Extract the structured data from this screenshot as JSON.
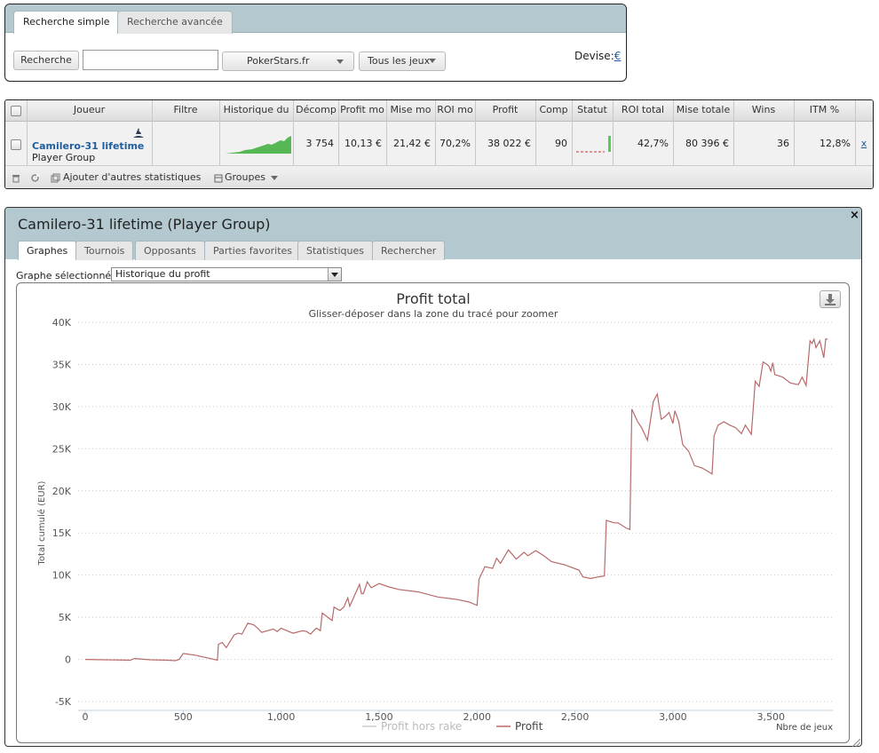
{
  "search": {
    "tabs": [
      "Recherche simple",
      "Recherche avancée"
    ],
    "search_button": "Recherche",
    "search_value": "",
    "site": "PokerStars.fr",
    "games": "Tous les jeux",
    "currency_label": "Devise:",
    "currency_symbol": "€"
  },
  "table": {
    "headers": [
      "Joueur",
      "Filtre",
      "Historique du",
      "Décomp",
      "Profit mo",
      "Mise mo",
      "ROI mo",
      "Profit",
      "Comp",
      "Statut",
      "ROI total",
      "Mise totale",
      "Wins",
      "ITM %"
    ],
    "row": {
      "player": "Camilero-31 lifetime",
      "group": "Player Group",
      "filter": "",
      "decomp": "3 754",
      "profit_avg": "10,13 €",
      "stake_avg": "21,42 €",
      "roi_avg": "70,2%",
      "profit": "38 022 €",
      "comp": "90",
      "roi_total": "42,7%",
      "stake_total": "80 396 €",
      "wins": "36",
      "itm": "12,8%",
      "remove": "x"
    },
    "footer": {
      "add_stats": "Ajouter d'autres statistiques",
      "groups": "Groupes"
    }
  },
  "player_panel": {
    "title": "Camilero-31 lifetime (Player Group)",
    "tabs": [
      "Graphes",
      "Tournois",
      "Opposants",
      "Parties favorites",
      "Statistiques",
      "Rechercher"
    ],
    "graph_label": "Graphe sélectionné :",
    "graph_selected": "Historique du profit",
    "close": "×"
  },
  "chart_data": {
    "type": "line",
    "title": "Profit total",
    "subtitle": "Glisser-déposer dans la zone du tracé pour zoomer",
    "xlabel": "Nbre de jeux",
    "ylabel": "Total cumulé (EUR)",
    "xlim": [
      0,
      3800
    ],
    "ylim": [
      -5000,
      40000
    ],
    "x_ticks": [
      0,
      500,
      1000,
      1500,
      2000,
      2500,
      3000,
      3500
    ],
    "x_tick_labels": [
      "0",
      "500",
      "1,000",
      "1,500",
      "2,000",
      "2,500",
      "3,000",
      "3,500"
    ],
    "y_ticks": [
      -5000,
      0,
      5000,
      10000,
      15000,
      20000,
      25000,
      30000,
      35000,
      40000
    ],
    "y_tick_labels": [
      "-5K",
      "0",
      "5K",
      "10K",
      "15K",
      "20K",
      "25K",
      "30K",
      "35K",
      "40K"
    ],
    "grid": true,
    "legend_position": "bottom-center",
    "series": [
      {
        "name": "Profit hors rake",
        "color": "#cccccc",
        "visible": false,
        "x": [],
        "y": []
      },
      {
        "name": "Profit",
        "color": "#b86a6a",
        "visible": true,
        "x": [
          0,
          100,
          230,
          250,
          330,
          420,
          460,
          480,
          500,
          560,
          620,
          675,
          680,
          700,
          720,
          760,
          780,
          800,
          830,
          860,
          880,
          900,
          960,
          980,
          1000,
          1060,
          1110,
          1130,
          1150,
          1180,
          1200,
          1210,
          1260,
          1270,
          1300,
          1320,
          1340,
          1350,
          1400,
          1410,
          1420,
          1440,
          1460,
          1500,
          1550,
          1600,
          1700,
          1800,
          1900,
          1960,
          2000,
          2010,
          2040,
          2080,
          2100,
          2120,
          2160,
          2200,
          2240,
          2260,
          2300,
          2340,
          2380,
          2450,
          2520,
          2540,
          2580,
          2620,
          2650,
          2660,
          2700,
          2720,
          2760,
          2780,
          2790,
          2820,
          2840,
          2870,
          2900,
          2920,
          2940,
          2960,
          2980,
          3000,
          3010,
          3030,
          3050,
          3080,
          3110,
          3150,
          3180,
          3200,
          3210,
          3230,
          3260,
          3290,
          3320,
          3350,
          3370,
          3400,
          3420,
          3440,
          3460,
          3480,
          3490,
          3500,
          3510,
          3520,
          3560,
          3600,
          3640,
          3660,
          3680,
          3700,
          3710,
          3720,
          3730,
          3750,
          3770,
          3780,
          3790
        ],
        "y": [
          0,
          -50,
          -100,
          100,
          -50,
          -100,
          -150,
          0,
          700,
          500,
          200,
          -100,
          1800,
          2000,
          1400,
          2900,
          3100,
          3000,
          4300,
          4100,
          3700,
          3200,
          3600,
          3300,
          3700,
          3100,
          3400,
          3300,
          3000,
          3700,
          3400,
          5500,
          4600,
          6200,
          5800,
          6200,
          7300,
          6300,
          8900,
          7800,
          7800,
          9200,
          8500,
          9000,
          8600,
          8300,
          8000,
          7400,
          7100,
          6800,
          6400,
          9500,
          11000,
          10800,
          12000,
          11400,
          13000,
          11900,
          12700,
          12300,
          12900,
          12300,
          11600,
          11200,
          10600,
          9800,
          9600,
          9800,
          9900,
          16500,
          16200,
          16200,
          15600,
          15400,
          29700,
          28200,
          27500,
          26000,
          30600,
          31500,
          28500,
          28800,
          29300,
          28000,
          29500,
          28200,
          25500,
          24700,
          23000,
          22700,
          22300,
          22000,
          26500,
          27800,
          28200,
          27800,
          27500,
          26800,
          27800,
          26700,
          33000,
          32400,
          35300,
          35000,
          34800,
          34200,
          35200,
          33800,
          33500,
          32800,
          32600,
          33500,
          32500,
          37800,
          37500,
          38000,
          37000,
          37800,
          35800,
          38022,
          38000
        ]
      }
    ]
  }
}
